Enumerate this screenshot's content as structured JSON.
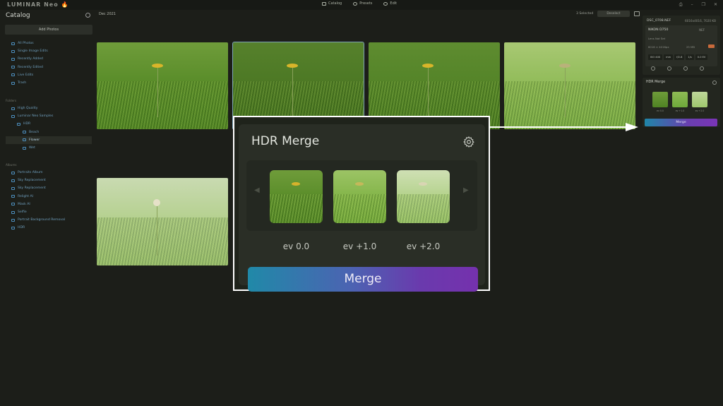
{
  "app": {
    "logo": "LUMINAR Neo"
  },
  "topnav": [
    {
      "label": "Catalog"
    },
    {
      "label": "Presets"
    },
    {
      "label": "Edit"
    }
  ],
  "window_controls": [
    "⎙",
    "–",
    "❐",
    "✕"
  ],
  "sidebar": {
    "title": "Catalog",
    "add_photos": "Add Photos",
    "items_top": [
      "All Photos",
      "Single Image Edits",
      "Recently Added",
      "Recently Edited",
      "Live Edits",
      "Trash"
    ],
    "folders_label": "Folders",
    "folders": [
      "High Quality",
      "Luminar Neo Samples",
      "HDR",
      "Beach",
      "Flower",
      "Wet"
    ],
    "albums_label": "Albums",
    "albums": [
      "Portraits Album",
      "Sky Replacement",
      "Sky Replacement",
      "Relight AI",
      "Mask AI",
      "Selfie",
      "Portrait Background Removal",
      "HDR"
    ]
  },
  "main": {
    "date": "Dec 2021",
    "selected": "3 Selected",
    "deselect": "Deselect"
  },
  "right_panel": {
    "file": "DSC_0708.NEF",
    "dims": "6016x4016, 7020 KB",
    "camera": "NIKON D750",
    "format": "NEF",
    "lens": "Lens Not Set",
    "line2": "6016 × 4016px",
    "line2b": "25 MB",
    "exif": [
      "ISO 400",
      "mm",
      "f/2.8",
      "1/s",
      "0.0 EV"
    ],
    "hdr_title": "HDR Merge",
    "ev_small": [
      "ev 0.0",
      "ev +1.0",
      "ev +2.0"
    ],
    "merge_small": "Merge"
  },
  "zoom": {
    "title": "HDR Merge",
    "ev": [
      "ev 0.0",
      "ev +1.0",
      "ev +2.0"
    ],
    "merge": "Merge"
  }
}
